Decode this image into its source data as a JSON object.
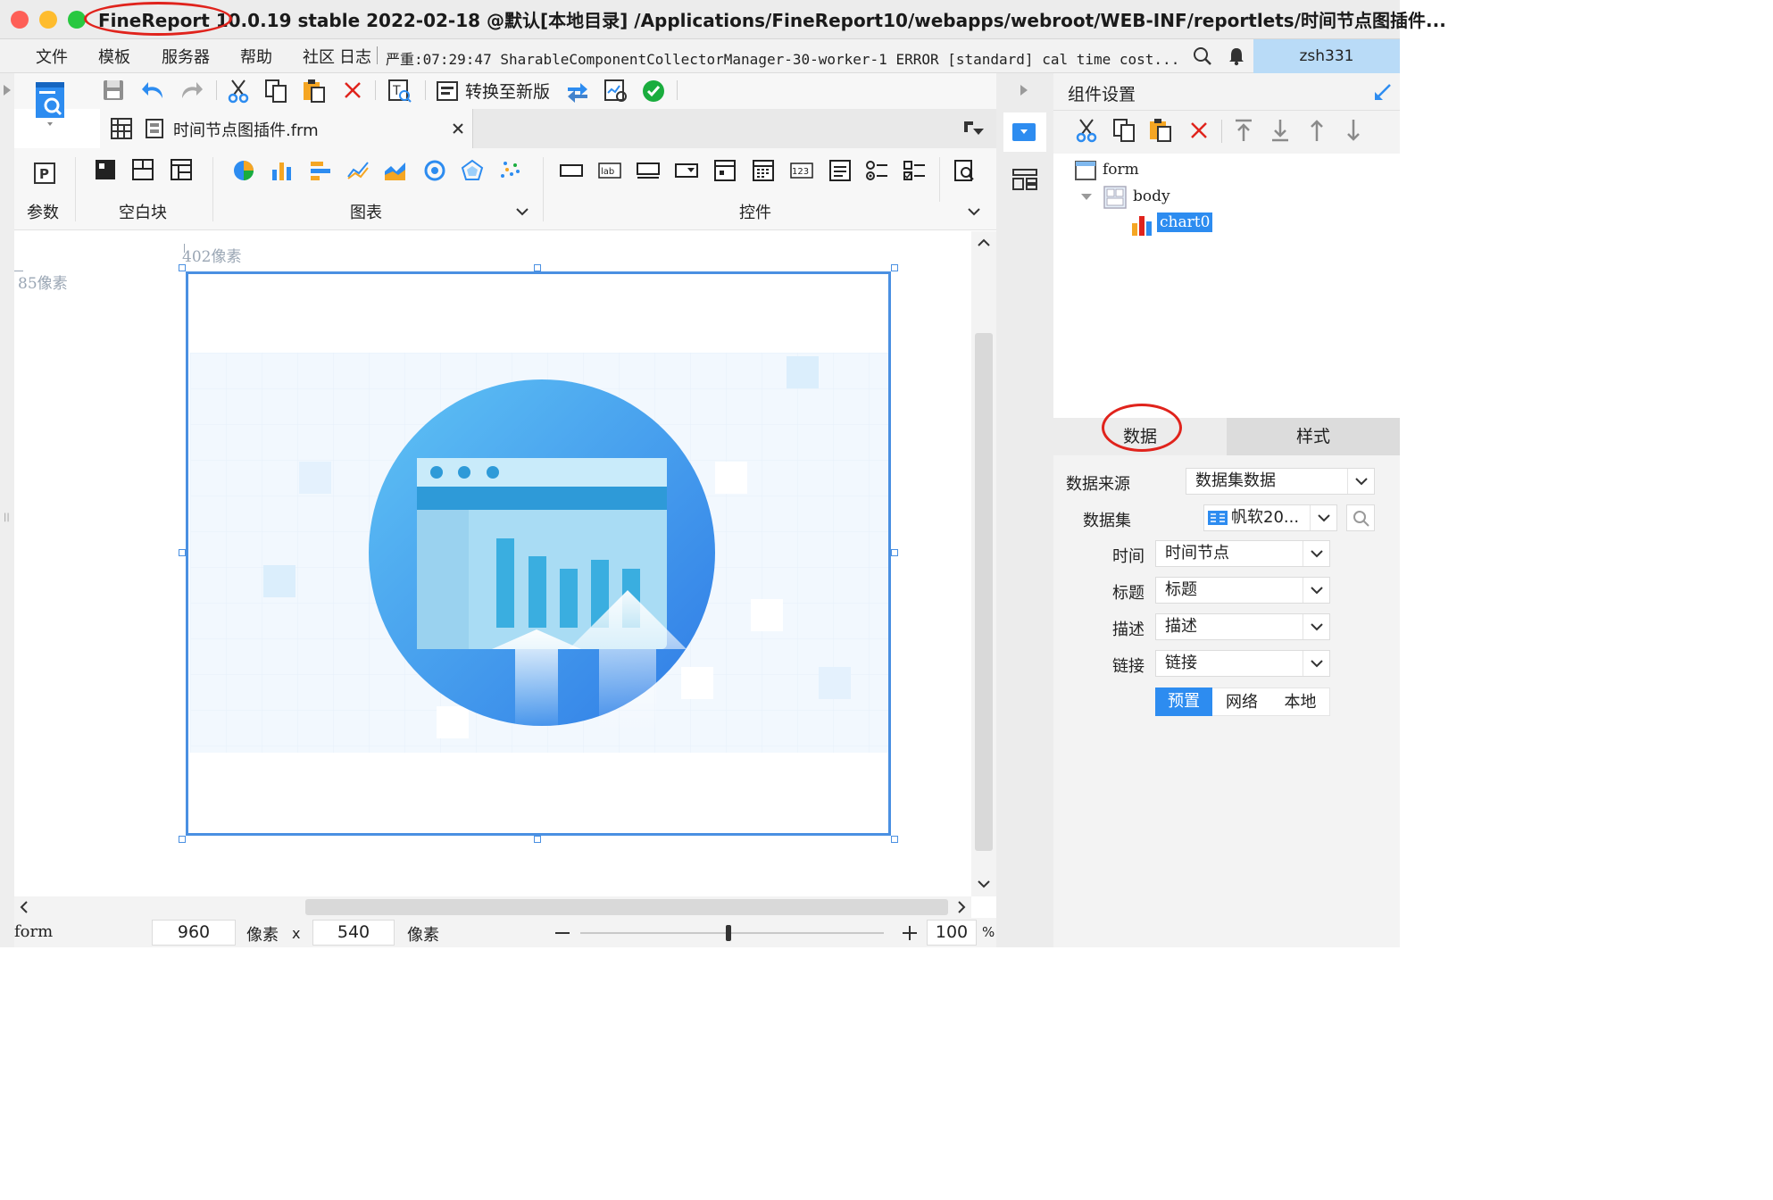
{
  "window": {
    "title": "FineReport 10.0.19 stable 2022-02-18 @默认[本地目录]   /Applications/FineReport10/webapps/webroot/WEB-INF/reportlets/时间节点图插件..."
  },
  "menu": {
    "items": [
      "文件",
      "模板",
      "服务器",
      "帮助",
      "社区",
      "日志"
    ],
    "log_text": "严重:07:29:47 SharableComponentCollectorManager-30-worker-1 ERROR [standard] cal time cost...",
    "user": "zsh331"
  },
  "toolbar": {
    "convert_label": "转换至新版"
  },
  "tab": {
    "file_name": "时间节点图插件.frm"
  },
  "widgets": {
    "param_label": "参数",
    "blank_label": "空白块",
    "chart_label": "图表",
    "control_label": "控件"
  },
  "canvas": {
    "width_ruler": "402像素",
    "height_ruler": "85像素"
  },
  "status": {
    "layout_name": "form",
    "width": "960",
    "unit1": "像素",
    "times": "x",
    "height": "540",
    "unit2": "像素",
    "zoom": "100",
    "zoom_unit": "%"
  },
  "panel": {
    "title": "组件设置",
    "tree": {
      "root": "form",
      "body": "body",
      "chart": "chart0"
    },
    "tabs": {
      "data": "数据",
      "style": "样式"
    },
    "fields": {
      "source_label": "数据来源",
      "source_value": "数据集数据",
      "dataset_label": "数据集",
      "dataset_value": "帆软20...",
      "time_label": "时间",
      "time_value": "时间节点",
      "title_label": "标题",
      "title_value": "标题",
      "desc_label": "描述",
      "desc_value": "描述",
      "link_label": "链接",
      "link_value": "链接"
    },
    "modes": {
      "preset": "预置",
      "network": "网络",
      "local": "本地"
    }
  },
  "colors": {
    "accent": "#2d8cf0",
    "annotation": "#e0231c",
    "selection": "#4a90e2"
  }
}
